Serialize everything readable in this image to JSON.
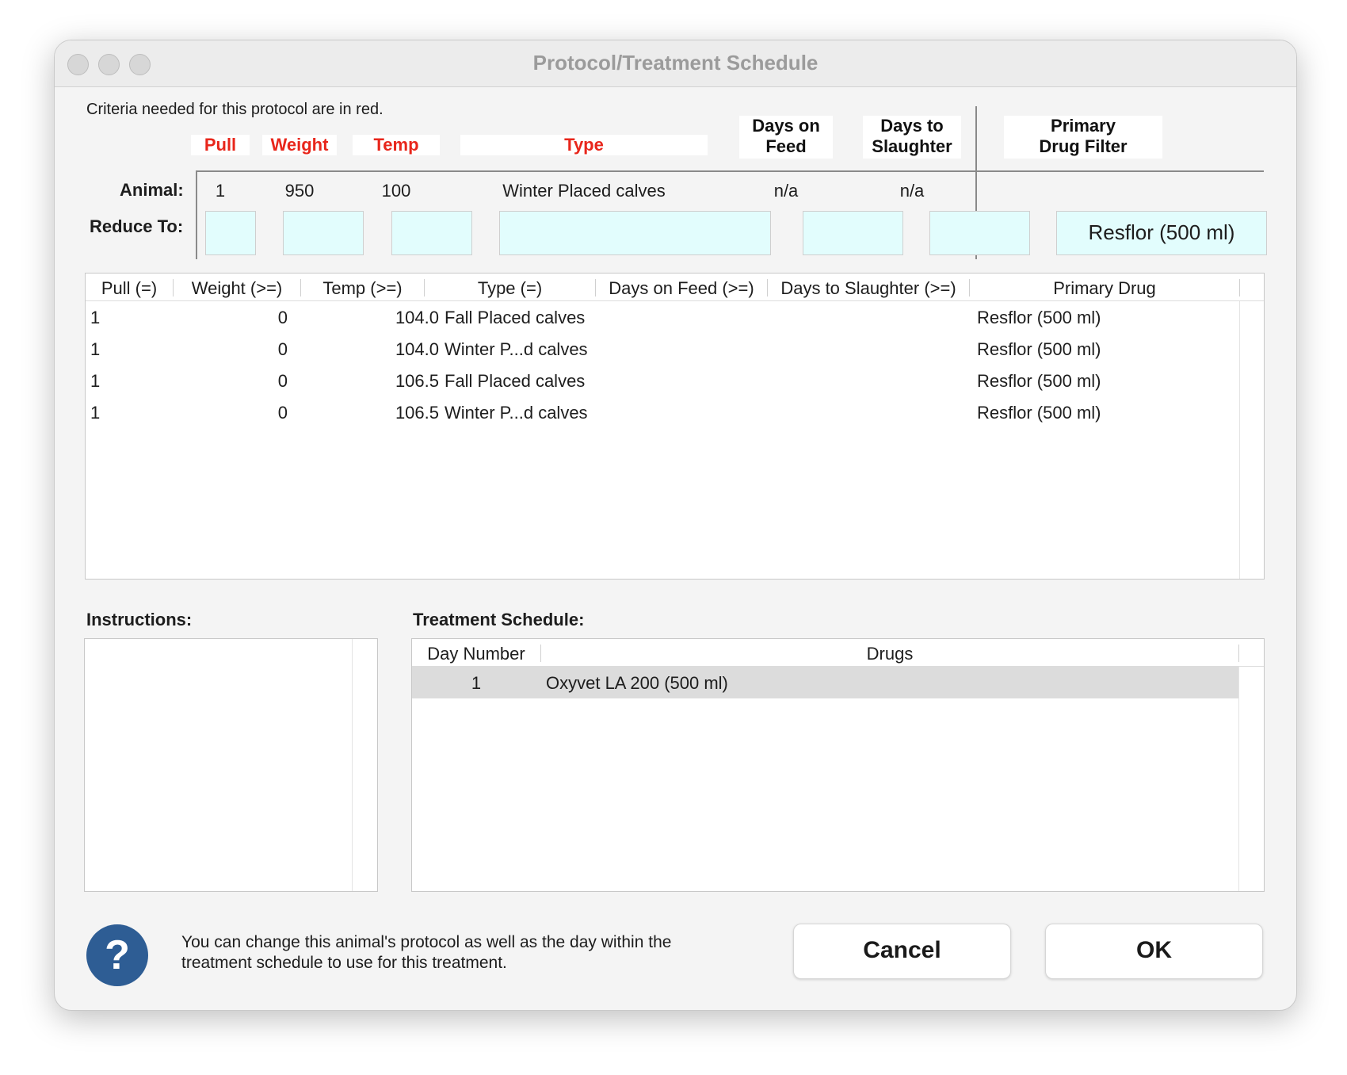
{
  "window": {
    "title": "Protocol/Treatment Schedule"
  },
  "note": "Criteria needed for this protocol are in red.",
  "criteria": {
    "headers": {
      "pull": "Pull",
      "weight": "Weight",
      "temp": "Temp",
      "type": "Type",
      "days_on_feed_1": "Days on",
      "days_on_feed_2": "Feed",
      "days_to_slaughter_1": "Days to",
      "days_to_slaughter_2": "Slaughter",
      "primary_drug_filter_1": "Primary",
      "primary_drug_filter_2": "Drug Filter"
    },
    "animal_label": "Animal:",
    "reduce_to_label": "Reduce To:",
    "animal": {
      "pull": "1",
      "weight": "950",
      "temp": "100",
      "type": "Winter Placed calves",
      "days_on_feed": "n/a",
      "days_to_slaughter": "n/a"
    },
    "reduce_to": {
      "pull": "",
      "weight": "",
      "temp": "",
      "type": "",
      "days_on_feed": "",
      "days_to_slaughter": "",
      "primary_drug_filter": "Resflor (500 ml)"
    }
  },
  "protocol_table": {
    "columns": [
      "Pull (=)",
      "Weight (>=)",
      "Temp (>=)",
      "Type (=)",
      "Days on Feed (>=)",
      "Days to Slaughter (>=)",
      "Primary Drug"
    ],
    "rows": [
      {
        "pull": "1",
        "weight": "0",
        "temp": "104.0",
        "type": "Fall Placed calves",
        "days_on_feed": "",
        "days_to_slaughter": "",
        "primary_drug": "Resflor (500 ml)"
      },
      {
        "pull": "1",
        "weight": "0",
        "temp": "104.0",
        "type": "Winter P...d calves",
        "days_on_feed": "",
        "days_to_slaughter": "",
        "primary_drug": "Resflor (500 ml)"
      },
      {
        "pull": "1",
        "weight": "0",
        "temp": "106.5",
        "type": "Fall Placed calves",
        "days_on_feed": "",
        "days_to_slaughter": "",
        "primary_drug": "Resflor (500 ml)"
      },
      {
        "pull": "1",
        "weight": "0",
        "temp": "106.5",
        "type": "Winter P...d calves",
        "days_on_feed": "",
        "days_to_slaughter": "",
        "primary_drug": "Resflor (500 ml)"
      }
    ]
  },
  "instructions": {
    "label": "Instructions:",
    "text": ""
  },
  "treatment_schedule": {
    "label": "Treatment Schedule:",
    "columns": [
      "Day Number",
      "Drugs"
    ],
    "rows": [
      {
        "day": "1",
        "drugs": "Oxyvet LA 200 (500 ml)"
      }
    ]
  },
  "footer": {
    "help_glyph": "?",
    "help_text_line1": "You can change this animal's protocol as well as the day within the",
    "help_text_line2": "treatment schedule to use for this treatment.",
    "cancel_label": "Cancel",
    "ok_label": "OK"
  },
  "colors": {
    "required": "#e8261b",
    "input_bg": "#e2fdfd",
    "help_icon": "#2e5d94",
    "selected_row": "#dcdcdc"
  }
}
